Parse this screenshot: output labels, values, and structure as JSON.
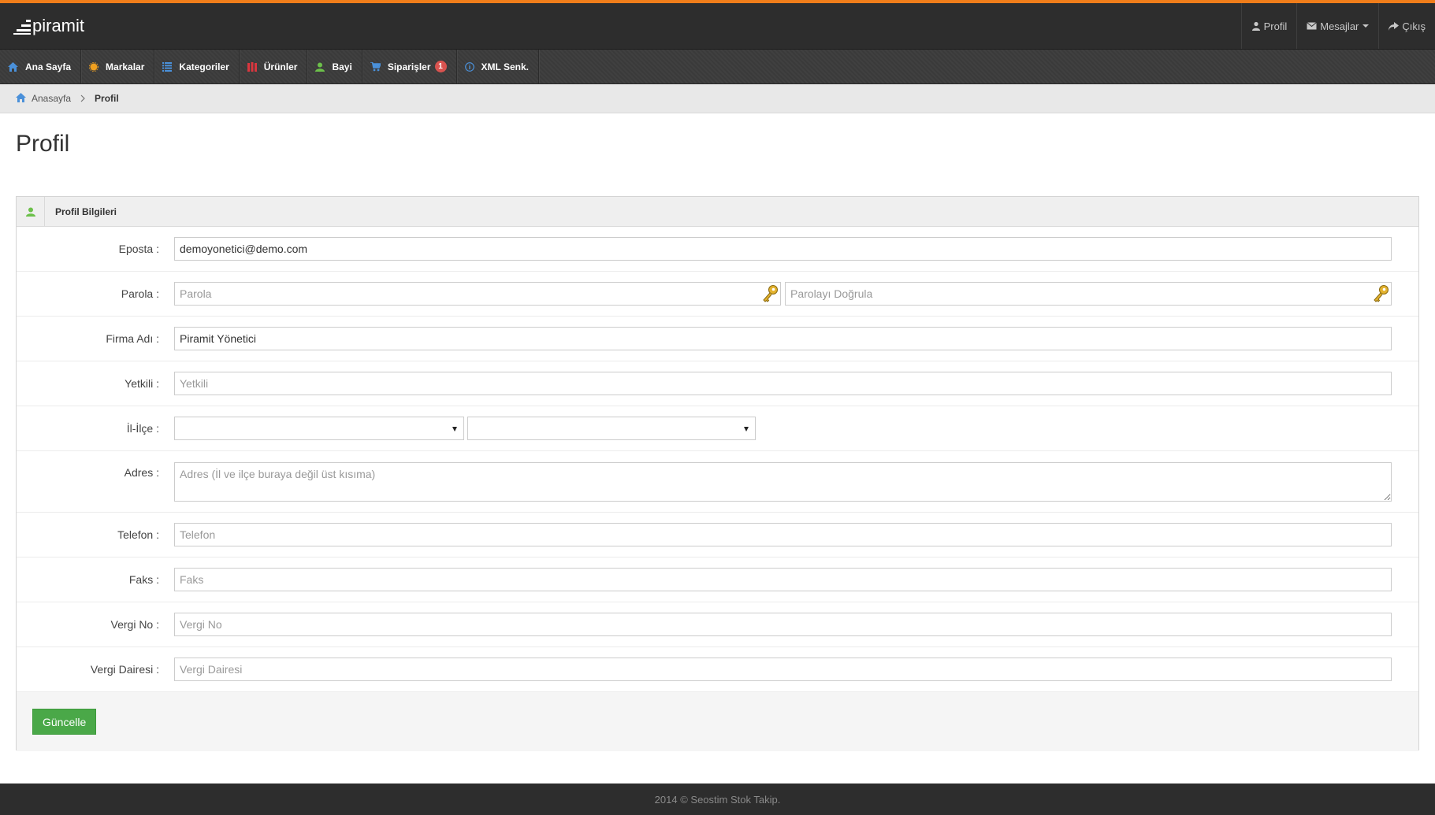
{
  "header": {
    "brand": "piramit",
    "profile_label": "Profil",
    "messages_label": "Mesajlar",
    "logout_label": "Çıkış"
  },
  "nav": {
    "items": [
      {
        "label": "Ana Sayfa",
        "icon": "home-icon",
        "color": "#4a90d9"
      },
      {
        "label": "Markalar",
        "icon": "brand-icon",
        "color": "#f0a020"
      },
      {
        "label": "Kategoriler",
        "icon": "list-icon",
        "color": "#4a90d9"
      },
      {
        "label": "Ürünler",
        "icon": "products-icon",
        "color": "#d9363e"
      },
      {
        "label": "Bayi",
        "icon": "user-icon",
        "color": "#6cc04a"
      },
      {
        "label": "Siparişler",
        "icon": "cart-icon",
        "color": "#4a90d9",
        "badge": "1"
      },
      {
        "label": "XML Senk.",
        "icon": "info-icon",
        "color": "#4a90d9"
      }
    ]
  },
  "breadcrumb": {
    "home": "Anasayfa",
    "current": "Profil"
  },
  "page": {
    "title": "Profil"
  },
  "panel": {
    "title": "Profil Bilgileri"
  },
  "form": {
    "email": {
      "label": "Eposta :",
      "value": "demoyonetici@demo.com"
    },
    "password": {
      "label": "Parola :",
      "placeholder": "Parola",
      "confirm_placeholder": "Parolayı Doğrula"
    },
    "company": {
      "label": "Firma Adı :",
      "value": "Piramit Yönetici"
    },
    "contact": {
      "label": "Yetkili :",
      "placeholder": "Yetkili"
    },
    "city": {
      "label": "İl-İlçe :"
    },
    "address": {
      "label": "Adres :",
      "placeholder": "Adres (İl ve ilçe buraya değil üst kısıma)"
    },
    "phone": {
      "label": "Telefon :",
      "placeholder": "Telefon"
    },
    "fax": {
      "label": "Faks :",
      "placeholder": "Faks"
    },
    "tax_no": {
      "label": "Vergi No :",
      "placeholder": "Vergi No"
    },
    "tax_office": {
      "label": "Vergi Dairesi :",
      "placeholder": "Vergi Dairesi"
    },
    "submit_label": "Güncelle"
  },
  "footer": {
    "text": "2014 © Seostim Stok Takip."
  }
}
